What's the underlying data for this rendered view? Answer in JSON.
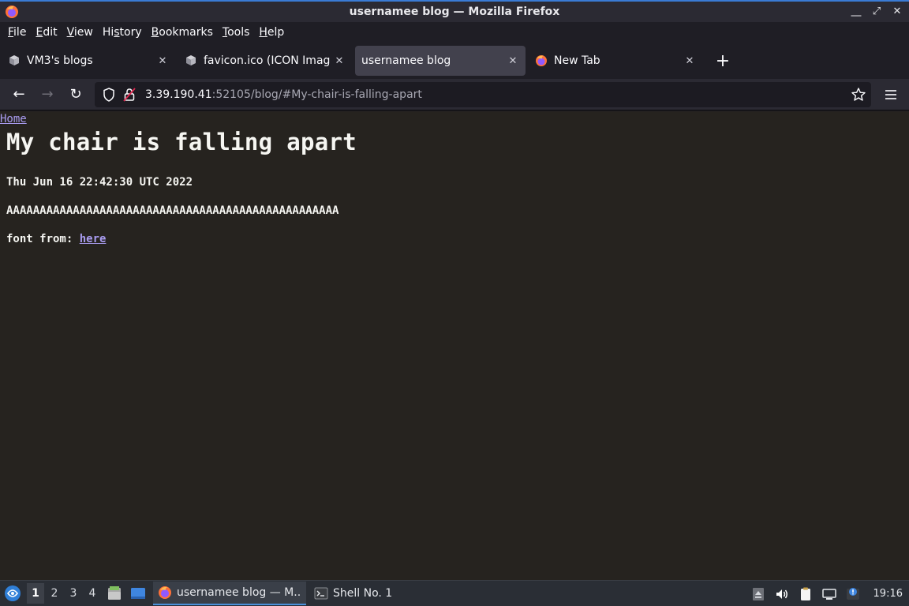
{
  "window": {
    "title": "usernamee blog — Mozilla Firefox",
    "controls": {
      "minimize": "⎽",
      "maximize": "⤢",
      "close": "✕"
    }
  },
  "menu": {
    "items": [
      {
        "accel": "F",
        "rest": "ile"
      },
      {
        "accel": "E",
        "rest": "dit"
      },
      {
        "accel": "V",
        "rest": "iew"
      },
      {
        "pre": "Hi",
        "accel": "s",
        "rest": "tory"
      },
      {
        "accel": "B",
        "rest": "ookmarks"
      },
      {
        "accel": "T",
        "rest": "ools"
      },
      {
        "accel": "H",
        "rest": "elp"
      }
    ]
  },
  "tabs": [
    {
      "label": "VM3's blogs",
      "icon": "server-icon",
      "active": false
    },
    {
      "label": "favicon.ico (ICON Image,",
      "icon": "server-icon",
      "active": false
    },
    {
      "label": "usernamee blog",
      "icon": "none",
      "active": true
    },
    {
      "label": "New Tab",
      "icon": "firefox-icon",
      "active": false
    }
  ],
  "tab_close_glyph": "✕",
  "newtab_glyph": "+",
  "nav": {
    "back": "←",
    "forward": "→",
    "reload": "↻",
    "url_host": "3.39.190.41",
    "url_rest": ":52105/blog/#My-chair-is-falling-apart"
  },
  "page": {
    "home_link": "Home",
    "heading": "My chair is falling apart",
    "date": "Thu Jun 16 22:42:30 UTC 2022",
    "body": "AAAAAAAAAAAAAAAAAAAAAAAAAAAAAAAAAAAAAAAAAAAAAAAAAA",
    "font_credit_prefix": "font from: ",
    "font_credit_link": "here"
  },
  "taskbar": {
    "workspaces": [
      "1",
      "2",
      "3",
      "4"
    ],
    "active_workspace": "1",
    "tasks": [
      {
        "label": "usernamee blog — M...",
        "icon": "firefox-icon",
        "active": true
      },
      {
        "label": "Shell No. 1",
        "icon": "terminal-icon",
        "active": false
      }
    ],
    "clock": "19:16"
  },
  "colors": {
    "accent": "#4a90d9",
    "link": "#a99cf0",
    "page_bg": "#26231f"
  }
}
